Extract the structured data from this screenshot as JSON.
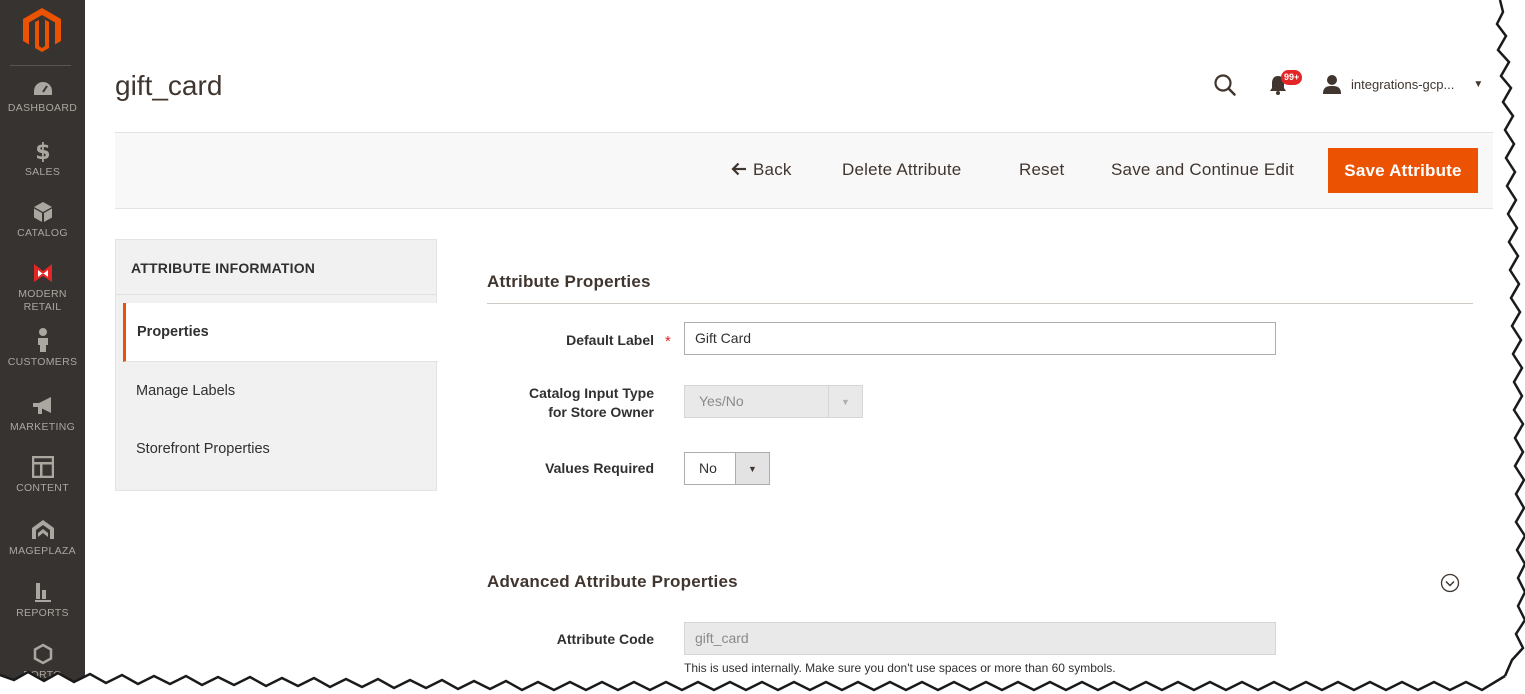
{
  "sidebar": {
    "items": [
      {
        "label": "DASHBOARD",
        "icon": "dashboard-icon"
      },
      {
        "label": "SALES",
        "icon": "dollar-icon"
      },
      {
        "label": "CATALOG",
        "icon": "cube-icon"
      },
      {
        "label": "MODERN\nRETAIL",
        "icon": "modern-retail-icon"
      },
      {
        "label": "CUSTOMERS",
        "icon": "person-icon"
      },
      {
        "label": "MARKETING",
        "icon": "megaphone-icon"
      },
      {
        "label": "CONTENT",
        "icon": "layout-icon"
      },
      {
        "label": "MAGEPLAZA",
        "icon": "mageplaza-icon"
      },
      {
        "label": "REPORTS",
        "icon": "bar-chart-icon"
      },
      {
        "label": "PORTO",
        "icon": "hexagon-icon"
      }
    ]
  },
  "header": {
    "title": "gift_card",
    "notification_count": "99+",
    "user_name": "integrations-gcp..."
  },
  "action_bar": {
    "back": "Back",
    "delete": "Delete Attribute",
    "reset": "Reset",
    "save_continue": "Save and Continue Edit",
    "save": "Save Attribute"
  },
  "tabs": {
    "title": "ATTRIBUTE INFORMATION",
    "items": [
      "Properties",
      "Manage Labels",
      "Storefront Properties"
    ]
  },
  "form": {
    "section1_title": "Attribute Properties",
    "default_label_label": "Default Label",
    "default_label_value": "Gift Card",
    "input_type_label_line1": "Catalog Input Type",
    "input_type_label_line2": "for Store Owner",
    "input_type_value": "Yes/No",
    "values_required_label": "Values Required",
    "values_required_value": "No",
    "section2_title": "Advanced Attribute Properties",
    "attribute_code_label": "Attribute Code",
    "attribute_code_value": "gift_card",
    "attribute_code_note": "This is used internally. Make sure you don't use spaces or more than 60 symbols."
  },
  "colors": {
    "sidebar_bg": "#373330",
    "accent": "#eb5202",
    "badge": "#e22626"
  }
}
